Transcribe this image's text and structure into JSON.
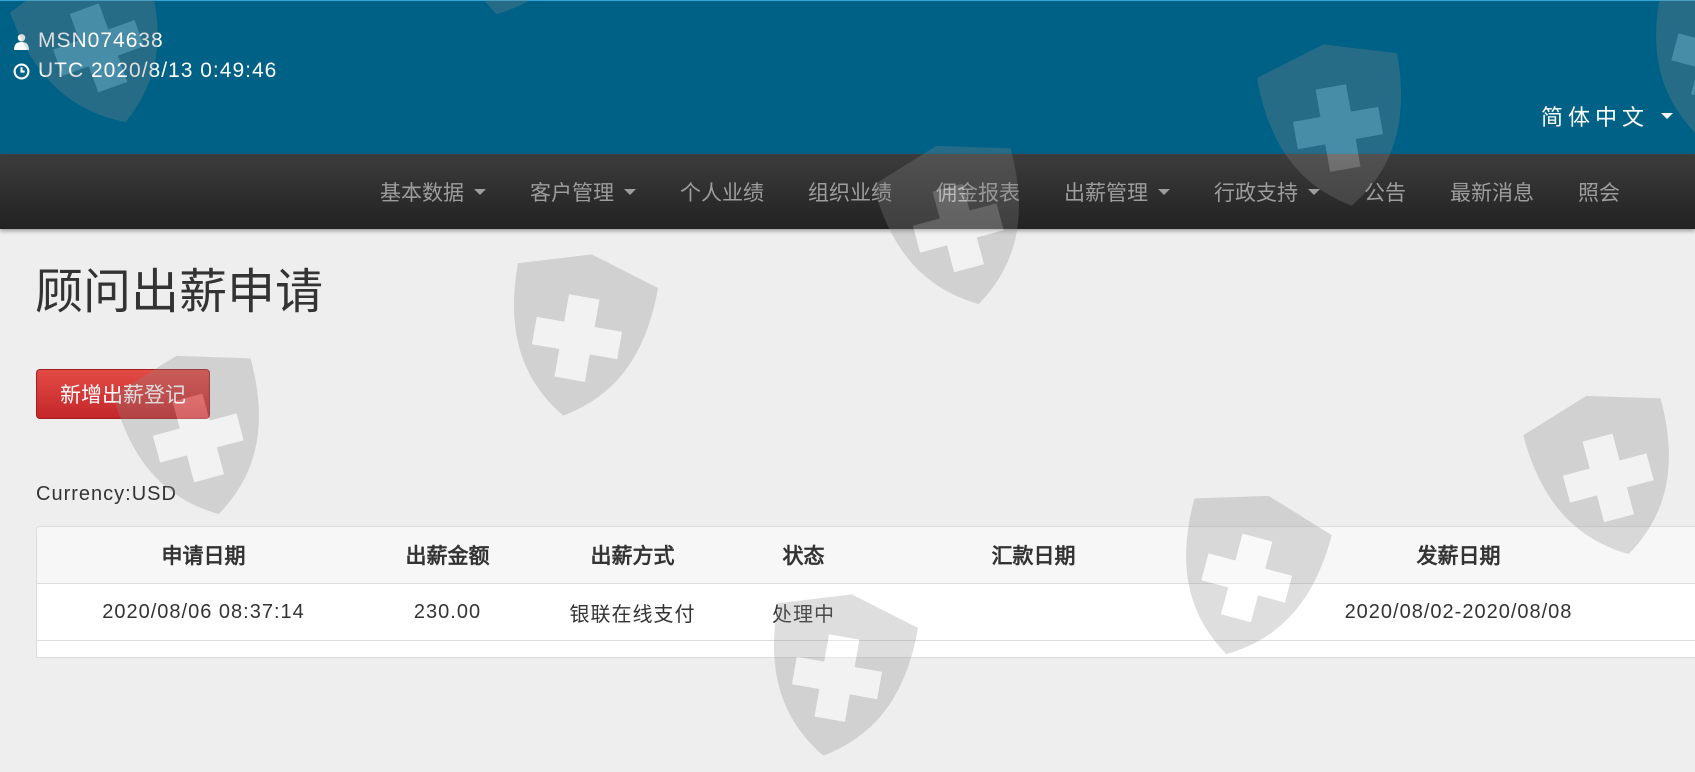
{
  "header": {
    "user_id": "MSN074638",
    "datetime": "UTC 2020/8/13 0:49:46",
    "language": "简体中文",
    "user_icon": "user-icon",
    "time_icon": "clock-icon"
  },
  "nav": {
    "items": [
      {
        "label": "基本数据",
        "dropdown": true
      },
      {
        "label": "客户管理",
        "dropdown": true
      },
      {
        "label": "个人业绩",
        "dropdown": false
      },
      {
        "label": "组织业绩",
        "dropdown": false
      },
      {
        "label": "佣金报表",
        "dropdown": false
      },
      {
        "label": "出薪管理",
        "dropdown": true
      },
      {
        "label": "行政支持",
        "dropdown": true
      },
      {
        "label": "公告",
        "dropdown": false
      },
      {
        "label": "最新消息",
        "dropdown": false
      },
      {
        "label": "照会",
        "dropdown": false
      }
    ]
  },
  "main": {
    "title": "顾问出薪申请",
    "add_button": "新增出薪登记",
    "currency": "Currency:USD"
  },
  "table": {
    "headers": [
      "申请日期",
      "出薪金额",
      "出薪方式",
      "状态",
      "汇款日期",
      "发薪日期"
    ],
    "rows": [
      [
        "2020/08/06 08:37:14",
        "230.00",
        "银联在线支付",
        "处理中",
        "",
        "2020/08/02-2020/08/08"
      ]
    ]
  },
  "colors": {
    "topbar": "#006187",
    "navbar": "#2a2a2a",
    "button": "#d9353a",
    "background": "#eeeeee"
  }
}
